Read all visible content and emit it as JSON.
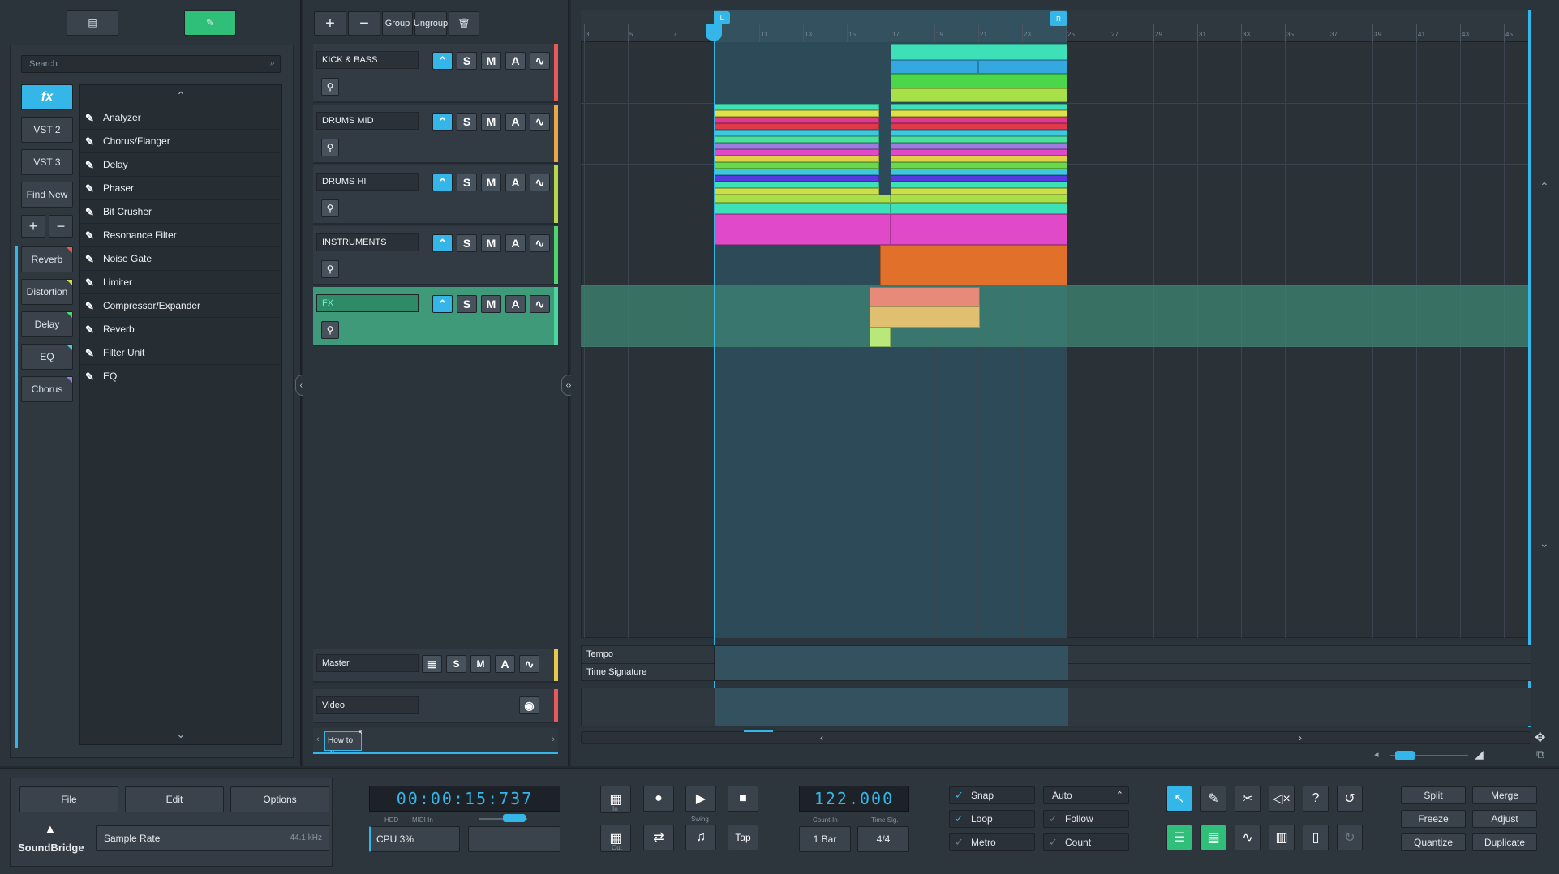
{
  "left": {
    "search_placeholder": "Search",
    "tabs": [
      "fx",
      "VST 2",
      "VST 3",
      "Find New"
    ],
    "add": "+",
    "remove": "−",
    "favorites": [
      {
        "label": "Reverb",
        "color": "#e85a5a"
      },
      {
        "label": "Distortion",
        "color": "#d8d84a"
      },
      {
        "label": "Delay",
        "color": "#4ad86a"
      },
      {
        "label": "EQ",
        "color": "#4ac8e8"
      },
      {
        "label": "Chorus",
        "color": "#9a7ae8"
      }
    ],
    "plugins": [
      "Analyzer",
      "Chorus/Flanger",
      "Delay",
      "Phaser",
      "Bit Crusher",
      "Resonance Filter",
      "Noise Gate",
      "Limiter",
      "Compressor/Expander",
      "Reverb",
      "Filter Unit",
      "EQ"
    ]
  },
  "tracks_panel": {
    "toolbar": {
      "add": "+",
      "remove": "−",
      "group": "Group",
      "ungroup": "Ungroup"
    },
    "tracks": [
      {
        "name": "KICK & BASS",
        "color": "#e85a5a"
      },
      {
        "name": "DRUMS MID",
        "color": "#e8a84a"
      },
      {
        "name": "DRUMS HI",
        "color": "#b8d84a"
      },
      {
        "name": "INSTRUMENTS",
        "color": "#4ad86a"
      },
      {
        "name": "FX",
        "color": "#4ad8a0"
      }
    ],
    "buttons": {
      "s": "S",
      "m": "M",
      "a": "A"
    },
    "master": {
      "name": "Master",
      "s": "S",
      "m": "M",
      "a": "A",
      "color": "#e8c84a"
    },
    "video": {
      "name": "Video",
      "color": "#e85a5a"
    },
    "tab": "How to ..."
  },
  "arrangement": {
    "ruler": [
      "3",
      "5",
      "7",
      "9",
      "11",
      "13",
      "15",
      "17",
      "19",
      "21",
      "23",
      "25",
      "27",
      "29",
      "31",
      "33",
      "35",
      "37",
      "39",
      "41",
      "43",
      "45"
    ],
    "loop_start": "L",
    "loop_end": "R",
    "tempo_label": "Tempo",
    "timesig_label": "Time Signature"
  },
  "bottom": {
    "file": "File",
    "edit": "Edit",
    "options": "Options",
    "brand": "SoundBridge",
    "sample_rate_label": "Sample Rate",
    "sample_rate_value": "44.1 kHz",
    "time": "00:00:15:737",
    "hdd": "HDD",
    "midi_in": "MIDI In",
    "cpu": "CPU 3%",
    "in": "In",
    "out": "Out",
    "swing": "Swing",
    "tap": "Tap",
    "tempo": "122.000",
    "count_in_label": "Count-In",
    "time_sig_label": "Time Sig.",
    "count_in": "1 Bar",
    "time_sig": "4/4",
    "snap": "Snap",
    "loop": "Loop",
    "metro": "Metro",
    "auto": "Auto",
    "follow": "Follow",
    "count": "Count",
    "split": "Split",
    "merge": "Merge",
    "freeze": "Freeze",
    "adjust": "Adjust",
    "quantize": "Quantize",
    "duplicate": "Duplicate"
  }
}
